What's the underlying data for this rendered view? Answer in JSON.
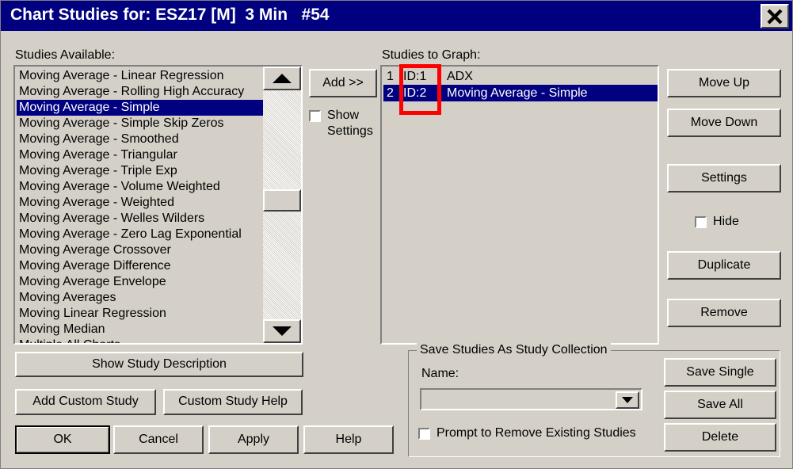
{
  "window": {
    "title": "Chart Studies for: ESZ17 [M]  3 Min   #54",
    "close_icon": "close-x-icon",
    "background_color": "#d4d0c8",
    "titlebar_color": "#000080",
    "selection_color": "#000080",
    "annotation_color": "#ff0000"
  },
  "available": {
    "label": "Studies Available:",
    "selected_index": 2,
    "items": [
      "Moving Average - Linear Regression",
      "Moving Average - Rolling High Accuracy",
      "Moving Average - Simple",
      "Moving Average - Simple Skip Zeros",
      "Moving Average - Smoothed",
      "Moving Average - Triangular",
      "Moving Average - Triple Exp",
      "Moving Average - Volume Weighted",
      "Moving Average - Weighted",
      "Moving Average - Welles Wilders",
      "Moving Average - Zero Lag Exponential",
      "Moving Average Crossover",
      "Moving Average Difference",
      "Moving Average Envelope",
      "Moving Averages",
      "Moving Linear Regression",
      "Moving Median",
      "Multiple All Charts"
    ],
    "scrollbar": {
      "up_icon": "triangle-up-icon",
      "down_icon": "triangle-down-icon"
    }
  },
  "middle": {
    "add_label": "Add >>",
    "show_settings_label": "Show\nSettings",
    "show_settings_checked": false
  },
  "graph": {
    "label": "Studies to Graph:",
    "selected_index": 1,
    "rows": [
      {
        "num": "1",
        "id": "ID:1",
        "name": "ADX"
      },
      {
        "num": "2",
        "id": "ID:2",
        "name": "Moving Average - Simple"
      }
    ]
  },
  "right_buttons": {
    "move_up": "Move Up",
    "move_down": "Move Down",
    "settings": "Settings",
    "hide_label": "Hide",
    "hide_checked": false,
    "duplicate": "Duplicate",
    "remove": "Remove"
  },
  "bottom_left": {
    "show_study_description": "Show Study Description",
    "add_custom_study": "Add Custom Study",
    "custom_study_help": "Custom Study Help",
    "ok": "OK",
    "cancel": "Cancel",
    "apply": "Apply",
    "help": "Help"
  },
  "save_group": {
    "title": "Save Studies As Study Collection",
    "name_label": "Name:",
    "name_value": "",
    "name_placeholder": "",
    "dropdown_icon": "triangle-down-icon",
    "prompt_label": "Prompt to Remove Existing Studies",
    "prompt_checked": false,
    "save_single": "Save Single",
    "save_all": "Save All",
    "delete": "Delete"
  }
}
